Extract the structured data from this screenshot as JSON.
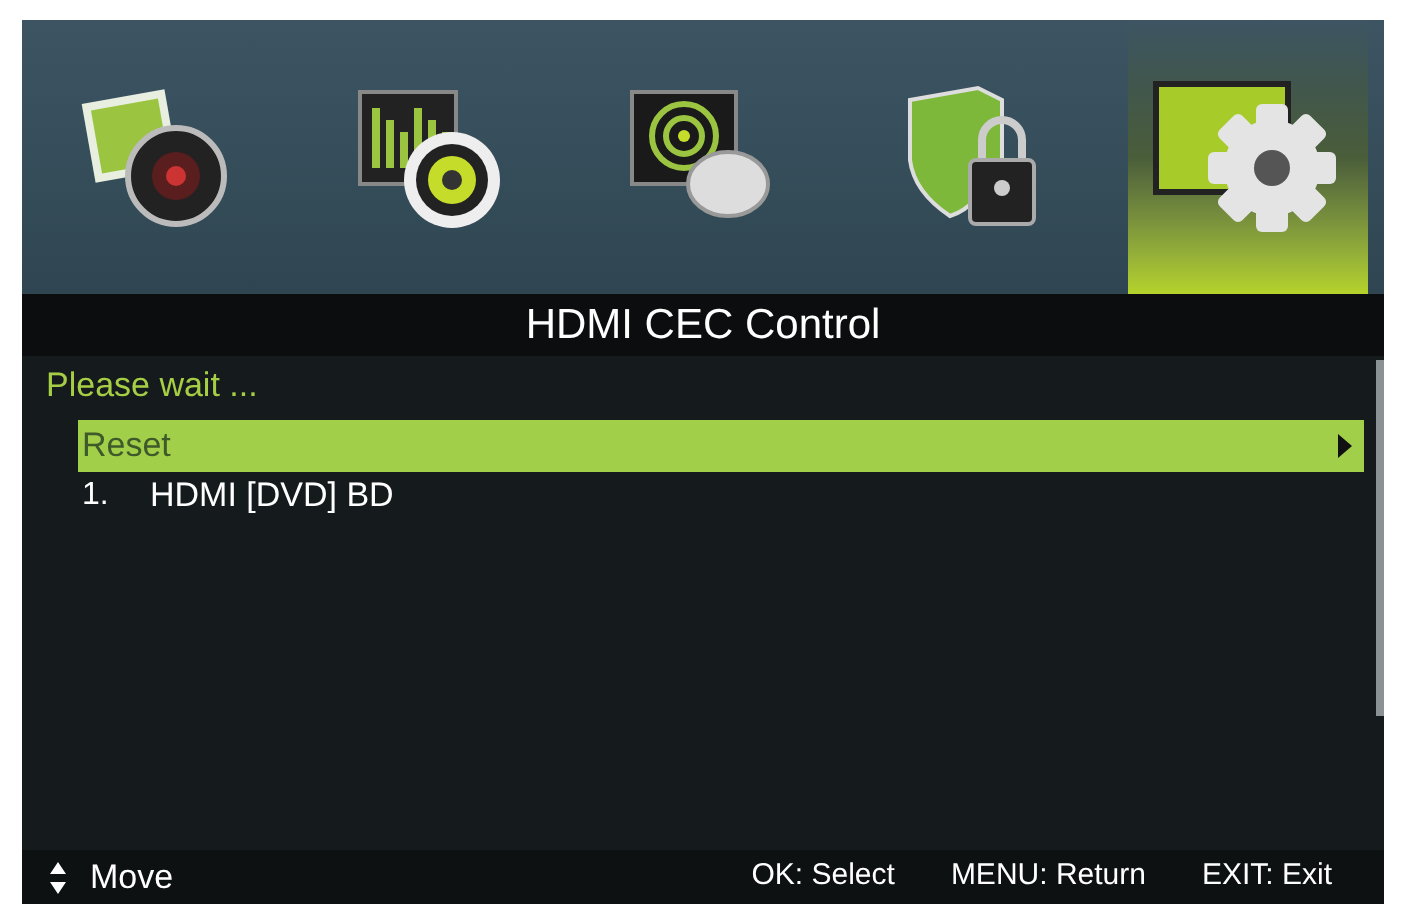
{
  "categories": [
    {
      "kind": "picture",
      "selected": false
    },
    {
      "kind": "sound",
      "selected": false
    },
    {
      "kind": "channel",
      "selected": false
    },
    {
      "kind": "lock",
      "selected": false
    },
    {
      "kind": "setup",
      "selected": true
    }
  ],
  "title": "HDMI CEC Control",
  "status": "Please wait ...",
  "items": [
    {
      "label": "Reset",
      "selected": true,
      "has_submenu": true
    },
    {
      "number": "1.",
      "label": "HDMI [DVD] BD",
      "selected": false,
      "has_submenu": false
    }
  ],
  "footer": {
    "move": "Move",
    "hints": [
      "OK: Select",
      "MENU: Return",
      "EXIT: Exit"
    ]
  }
}
